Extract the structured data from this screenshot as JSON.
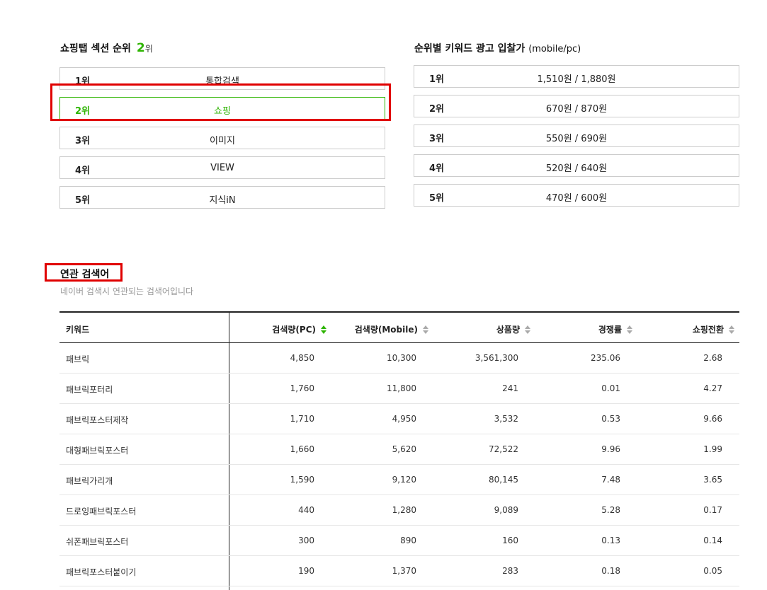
{
  "shopping_section": {
    "title": "쇼핑탭 섹션 순위",
    "rank_value": "2",
    "rank_unit": "위",
    "items": [
      {
        "rank": "1위",
        "name": "통합검색"
      },
      {
        "rank": "2위",
        "name": "쇼핑"
      },
      {
        "rank": "3위",
        "name": "이미지"
      },
      {
        "rank": "4위",
        "name": "VIEW"
      },
      {
        "rank": "5위",
        "name": "지식iN"
      }
    ],
    "active_index": 1
  },
  "bid_section": {
    "title": "순위별 키워드 광고 입찰가",
    "title_suffix": "(mobile/pc)",
    "items": [
      {
        "rank": "1위",
        "price": "1,510원 / 1,880원"
      },
      {
        "rank": "2위",
        "price": "670원 / 870원"
      },
      {
        "rank": "3위",
        "price": "550원 / 690원"
      },
      {
        "rank": "4위",
        "price": "520원 / 640원"
      },
      {
        "rank": "5위",
        "price": "470원 / 600원"
      }
    ]
  },
  "related": {
    "title": "연관 검색어",
    "subtitle": "네이버 검색시 연관되는 검색어입니다",
    "columns": [
      "키워드",
      "검색량(PC)",
      "검색량(Mobile)",
      "상품량",
      "경쟁률",
      "쇼핑전환"
    ],
    "sorted_column": 1,
    "rows": [
      [
        "패브릭",
        "4,850",
        "10,300",
        "3,561,300",
        "235.06",
        "2.68"
      ],
      [
        "패브릭포터리",
        "1,760",
        "11,800",
        "241",
        "0.01",
        "4.27"
      ],
      [
        "패브릭포스터제작",
        "1,710",
        "4,950",
        "3,532",
        "0.53",
        "9.66"
      ],
      [
        "대형패브릭포스터",
        "1,660",
        "5,620",
        "72,522",
        "9.96",
        "1.99"
      ],
      [
        "패브릭가리개",
        "1,590",
        "9,120",
        "80,145",
        "7.48",
        "3.65"
      ],
      [
        "드로잉패브릭포스터",
        "440",
        "1,280",
        "9,089",
        "5.28",
        "0.17"
      ],
      [
        "쉬폰패브릭포스터",
        "300",
        "890",
        "160",
        "0.13",
        "0.14"
      ],
      [
        "패브릭포스터붙이기",
        "190",
        "1,370",
        "283",
        "0.18",
        "0.05"
      ]
    ]
  },
  "colors": {
    "accent_green": "#2db400",
    "highlight_red": "#e00000"
  }
}
